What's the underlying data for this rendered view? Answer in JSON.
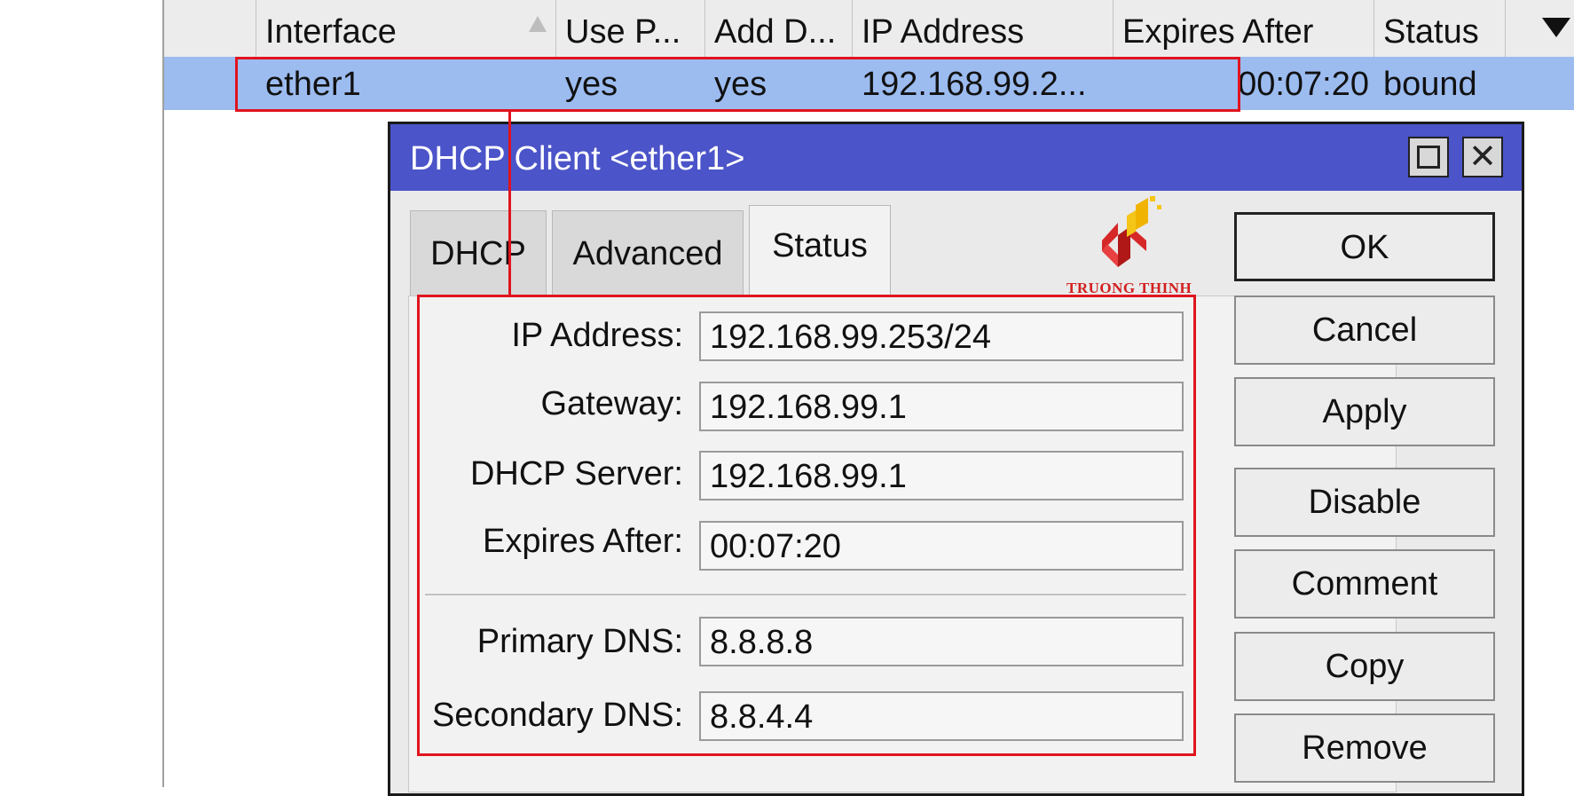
{
  "list": {
    "columns": [
      "Interface",
      "Use P...",
      "Add D...",
      "IP Address",
      "Expires After",
      "Status"
    ],
    "row": {
      "interface": "ether1",
      "use_peer": "yes",
      "add_default": "yes",
      "ip_address": "192.168.99.2...",
      "expires_after": "00:07:20",
      "status": "bound"
    }
  },
  "dialog": {
    "title": "DHCP  Client <ether1>",
    "tabs": [
      "DHCP",
      "Advanced",
      "Status"
    ],
    "active_tab": "Status",
    "logo_text": "TRUONG THINH",
    "fields": {
      "ip_address": {
        "label": "IP Address:",
        "value": "192.168.99.253/24"
      },
      "gateway": {
        "label": "Gateway:",
        "value": "192.168.99.1"
      },
      "dhcp_server": {
        "label": "DHCP Server:",
        "value": "192.168.99.1"
      },
      "expires_after": {
        "label": "Expires After:",
        "value": "00:07:20"
      },
      "primary_dns": {
        "label": "Primary DNS:",
        "value": "8.8.8.8"
      },
      "secondary_dns": {
        "label": "Secondary DNS:",
        "value": "8.8.4.4"
      }
    },
    "buttons": {
      "ok": "OK",
      "cancel": "Cancel",
      "apply": "Apply",
      "disable": "Disable",
      "comment": "Comment",
      "copy": "Copy",
      "remove": "Remove"
    }
  },
  "colors": {
    "titlebar": "#4b54c8",
    "selected_row": "#9cbcf0",
    "highlight": "#e0141e"
  },
  "icons": [
    "sort-ascending-icon",
    "column-dropdown-icon",
    "maximize-icon",
    "close-icon"
  ]
}
